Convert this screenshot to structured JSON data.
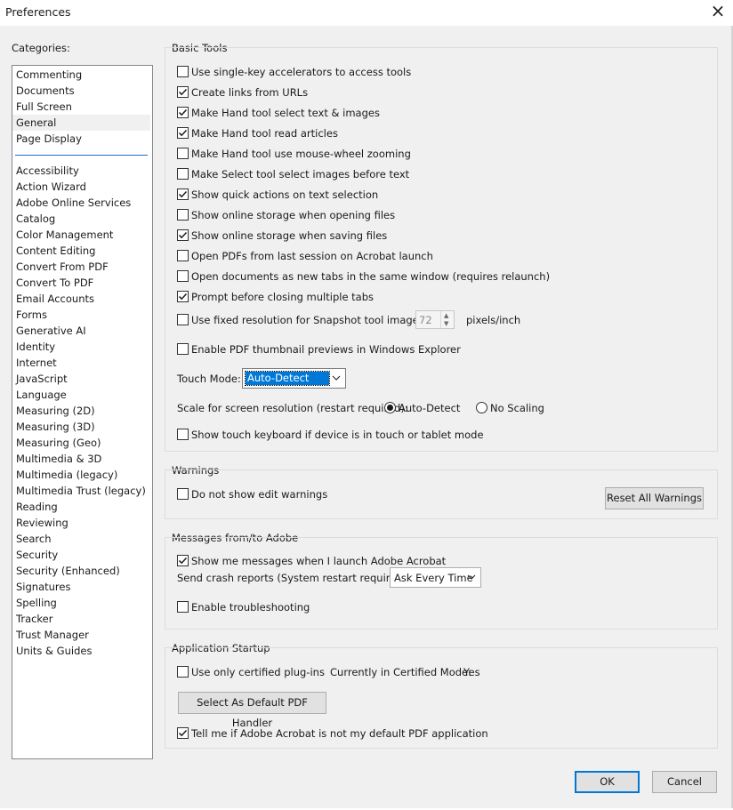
{
  "window": {
    "title": "Preferences",
    "close_glyph": "×",
    "close_icon": "close-icon"
  },
  "categories": {
    "label": "Categories:",
    "top_items": [
      "Commenting",
      "Documents",
      "Full Screen",
      "General",
      "Page Display"
    ],
    "selected": "General",
    "items": [
      "Accessibility",
      "Action Wizard",
      "Adobe Online Services",
      "Catalog",
      "Color Management",
      "Content Editing",
      "Convert From PDF",
      "Convert To PDF",
      "Email Accounts",
      "Forms",
      "Generative AI",
      "Identity",
      "Internet",
      "JavaScript",
      "Language",
      "Measuring (2D)",
      "Measuring (3D)",
      "Measuring (Geo)",
      "Multimedia & 3D",
      "Multimedia (legacy)",
      "Multimedia Trust (legacy)",
      "Reading",
      "Reviewing",
      "Search",
      "Security",
      "Security (Enhanced)",
      "Signatures",
      "Spelling",
      "Tracker",
      "Trust Manager",
      "Units & Guides"
    ]
  },
  "basic_tools": {
    "title": "Basic Tools",
    "options": [
      {
        "label": "Use single-key accelerators to access tools",
        "checked": false
      },
      {
        "label": "Create links from URLs",
        "checked": true
      },
      {
        "label": "Make Hand tool select text & images",
        "checked": true
      },
      {
        "label": "Make Hand tool read articles",
        "checked": true
      },
      {
        "label": "Make Hand tool use mouse-wheel zooming",
        "checked": false
      },
      {
        "label": "Make Select tool select images before text",
        "checked": false
      },
      {
        "label": "Show quick actions on text selection",
        "checked": true
      },
      {
        "label": "Show online storage when opening files",
        "checked": false
      },
      {
        "label": "Show online storage when saving files",
        "checked": true
      },
      {
        "label": "Open PDFs from last session on Acrobat launch",
        "checked": false
      },
      {
        "label": "Open documents as new tabs in the same window (requires relaunch)",
        "checked": false
      },
      {
        "label": "Prompt before closing multiple tabs",
        "checked": true
      },
      {
        "label": "Use fixed resolution for Snapshot tool images:",
        "checked": false
      }
    ],
    "snapshot_value": "72",
    "snapshot_unit": "pixels/inch",
    "thumbnail": {
      "label": "Enable PDF thumbnail previews in Windows Explorer",
      "checked": false
    },
    "touch_mode_label": "Touch Mode:",
    "touch_mode_value": "Auto-Detect",
    "scale_label": "Scale for screen resolution (restart required):",
    "scale_options": [
      {
        "label": "Auto-Detect",
        "selected": true
      },
      {
        "label": "No Scaling",
        "selected": false
      }
    ],
    "touch_keyboard": {
      "label": "Show touch keyboard if device is in touch or tablet mode",
      "checked": false
    }
  },
  "warnings": {
    "title": "Warnings",
    "edit_warnings": {
      "label": "Do not show edit warnings",
      "checked": false
    },
    "reset_button": "Reset All Warnings"
  },
  "messages": {
    "title": "Messages from/to Adobe",
    "launch_messages": {
      "label": "Show me messages when I launch Adobe Acrobat",
      "checked": true
    },
    "crash_label": "Send crash reports (System restart required):",
    "crash_value": "Ask Every Time",
    "troubleshooting": {
      "label": "Enable troubleshooting",
      "checked": false
    }
  },
  "startup": {
    "title": "Application Startup",
    "certified": {
      "label": "Use only certified plug-ins",
      "checked": false
    },
    "certified_mode_label": "Currently in Certified Mode:",
    "certified_mode_value": "Yes",
    "default_handler_button": "Select As Default PDF Handler",
    "default_app": {
      "label": "Tell me if Adobe Acrobat is not my default PDF application",
      "checked": true
    }
  },
  "footer": {
    "ok": "OK",
    "cancel": "Cancel"
  },
  "colors": {
    "accent": "#0078d7",
    "selection": "#0078d7",
    "separator": "#1e6fc6"
  }
}
